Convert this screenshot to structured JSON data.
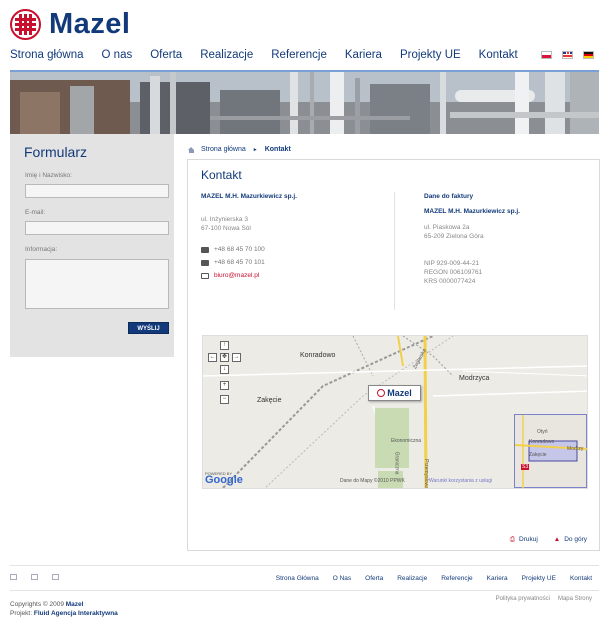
{
  "brand": {
    "logo_text": "Mazel",
    "logo_icon": "mazel-cross-logo-icon"
  },
  "nav": {
    "items": [
      "Strona główna",
      "O nas",
      "Oferta",
      "Realizacje",
      "Referencje",
      "Kariera",
      "Projekty UE",
      "Kontakt"
    ],
    "languages": [
      "pl-flag-icon",
      "gb-flag-icon",
      "de-flag-icon"
    ]
  },
  "form": {
    "title": "Formularz",
    "name_label": "Imię i Nazwisko:",
    "email_label": "E-mail:",
    "info_label": "Informacja:",
    "submit_label": "WYŚLIJ"
  },
  "breadcrumb": {
    "home": "Strona główna",
    "current": "Kontakt"
  },
  "contact": {
    "title": "Kontakt",
    "company": "MAZEL M.H. Mazurkiewicz sp.j.",
    "address_line1": "ul. Inżynierska 3",
    "address_line2": "67-100 Nowa Sól",
    "phone": "+48 68 45 70 100",
    "fax": "+48 68 45 70 101",
    "email": "biuro@mazel.pl",
    "invoice_title": "Dane do faktury",
    "invoice_company": "MAZEL M.H. Mazurkiewicz sp.j.",
    "invoice_address_line1": "ul. Piaskowa 2a",
    "invoice_address_line2": "65-209 Zielona Góra",
    "nip": "NIP 929-009-44-21",
    "regon": "REGON 006109761",
    "krs": "KRS 0000077424"
  },
  "map": {
    "labels": {
      "konradowo": "Konradowo",
      "modrzyca": "Modrzyca",
      "zakecie": "Zakęcie",
      "ekonomiczna": "Ekonomiczna",
      "granice": "Graniczna",
      "zeglarska": "Żeglarska",
      "przemyslowa": "Przemysłowa"
    },
    "pin_label": "Mazel",
    "copyright": "Dane do Mapy ©2010 PPWK",
    "terms": "Warunki korzystania z usługi",
    "powered": "POWERED BY",
    "google": "Google",
    "overview": {
      "otyn": "Otyń",
      "konradowo": "Konradowo",
      "zakecie": "Zakęcie",
      "modrzyca": "Modrzy",
      "road": "S3"
    }
  },
  "tools": {
    "print": "Drukuj",
    "top": "Do góry"
  },
  "footer": {
    "nav": [
      "Strona Główna",
      "O Nas",
      "Oferta",
      "Realizacje",
      "Referencje",
      "Kariera",
      "Projekty UE",
      "Kontakt"
    ],
    "copyright_prefix": "Copyrights © 2009",
    "copyright_name": "Mazel",
    "project_prefix": "Projekt:",
    "project_name": "Fluid Agencja Interaktywna",
    "privacy": "Polityka prywatności",
    "sitemap": "Mapa Strony"
  }
}
